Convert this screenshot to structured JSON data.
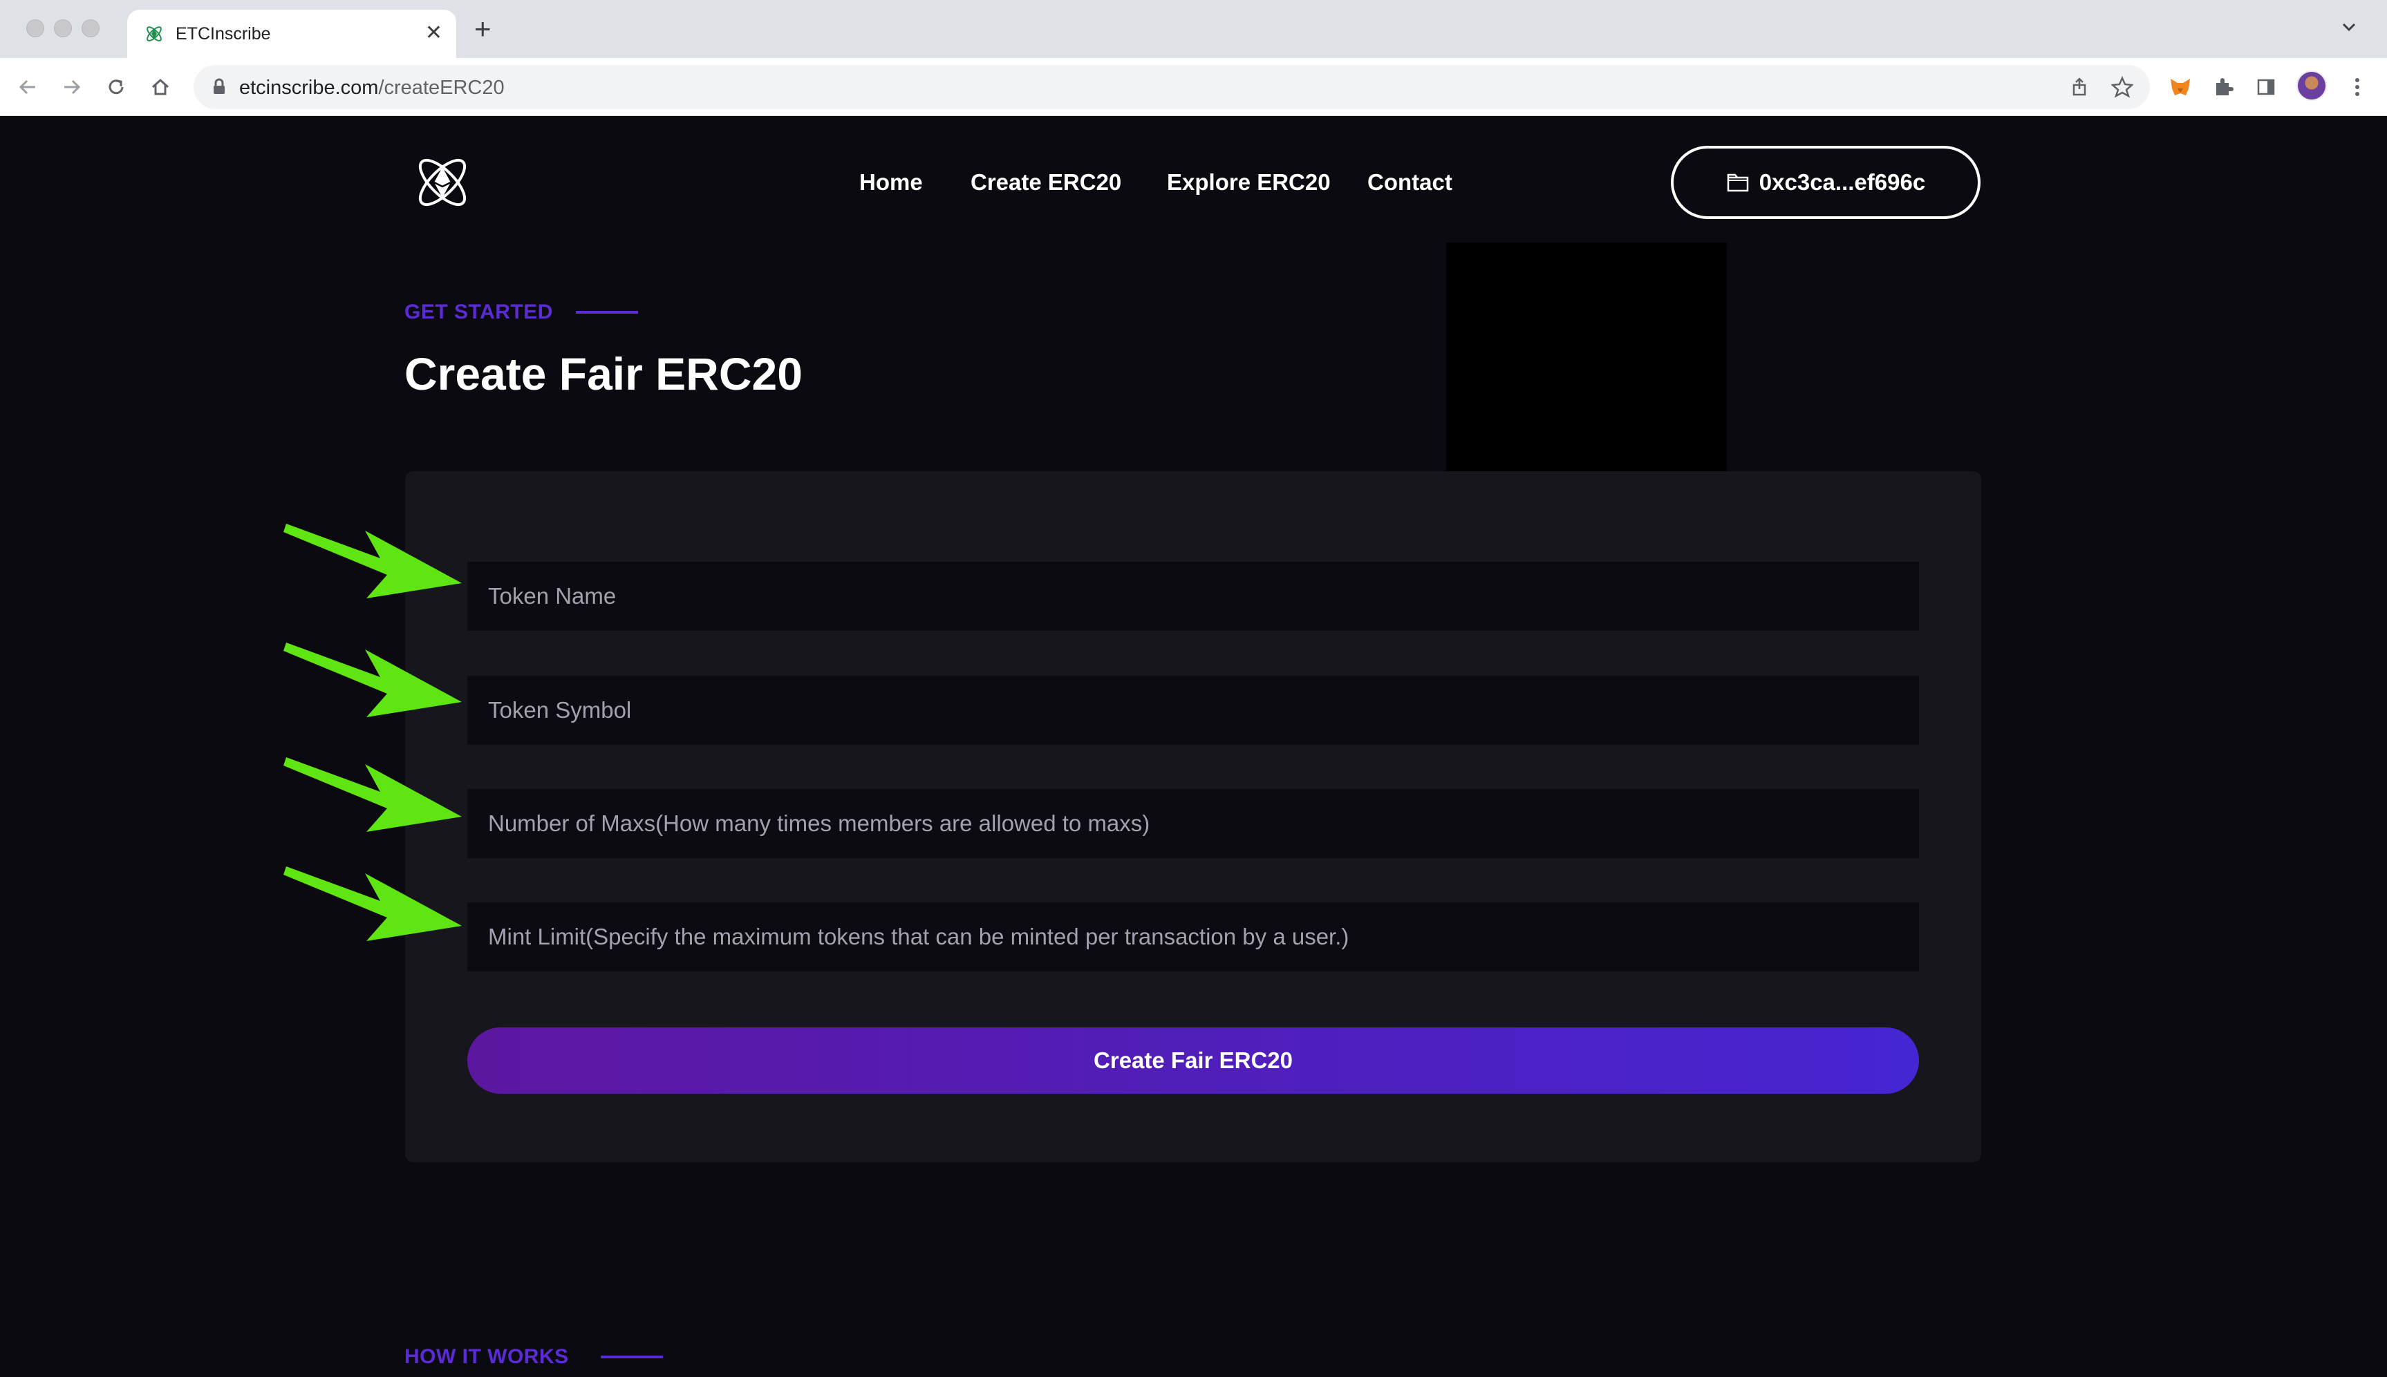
{
  "browser": {
    "tab_title": "ETCInscribe",
    "url_domain": "etcinscribe.com",
    "url_path": "/createERC20",
    "new_tab_symbol": "+",
    "close_symbol": "✕"
  },
  "header": {
    "nav": [
      "Home",
      "Create ERC20",
      "Explore ERC20",
      "Contact"
    ],
    "wallet_address": "0xc3ca...ef696c"
  },
  "hero": {
    "eyebrow": "GET STARTED",
    "title": "Create Fair ERC20"
  },
  "form": {
    "token_name_placeholder": "Token Name",
    "token_symbol_placeholder": "Token Symbol",
    "max_count_placeholder": "Number of Maxs(How many times members are allowed to maxs)",
    "mint_limit_placeholder": "Mint Limit(Specify the maximum tokens that can be minted per transaction by a user.)",
    "submit_label": "Create Fair ERC20"
  },
  "next_section": {
    "eyebrow": "HOW IT WORKS"
  },
  "colors": {
    "accent": "#5b2bd6",
    "annotation_arrow": "#5fe512",
    "page_bg": "#0b0a10",
    "card_bg": "#17161d"
  }
}
